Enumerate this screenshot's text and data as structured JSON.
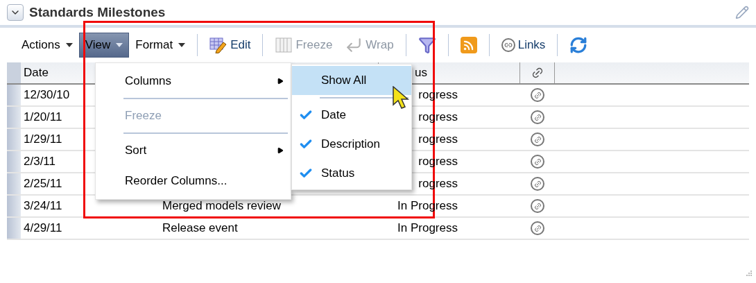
{
  "panel": {
    "title": "Standards Milestones",
    "expanded": true
  },
  "toolbar": [
    {
      "kind": "menu",
      "label": "Actions",
      "selected": false,
      "disabled": false
    },
    {
      "kind": "menu",
      "label": "View",
      "selected": true,
      "disabled": false
    },
    {
      "kind": "menu",
      "label": "Format",
      "selected": false,
      "disabled": false
    },
    {
      "kind": "separator"
    },
    {
      "kind": "edit",
      "label": "Edit",
      "selected": false,
      "disabled": false
    },
    {
      "kind": "separator"
    },
    {
      "kind": "freeze",
      "label": "Freeze",
      "selected": false,
      "disabled": true
    },
    {
      "kind": "wrap",
      "label": "Wrap",
      "selected": false,
      "disabled": true
    },
    {
      "kind": "separator"
    },
    {
      "kind": "filter",
      "selected": false
    },
    {
      "kind": "separator"
    },
    {
      "kind": "rss",
      "selected": false
    },
    {
      "kind": "separator"
    },
    {
      "kind": "links",
      "label": "Links",
      "selected": false,
      "disabled": false
    },
    {
      "kind": "separator"
    },
    {
      "kind": "refresh",
      "selected": false
    }
  ],
  "table": {
    "columns": [
      {
        "kind": "text",
        "label": "Date"
      },
      {
        "kind": "text"
      },
      {
        "kind": "text",
        "label": "us"
      },
      {
        "kind": "link"
      }
    ],
    "rows": [
      {
        "date": "12/30/10",
        "status": "rogress"
      },
      {
        "date": "1/20/11",
        "status": "rogress"
      },
      {
        "date": "1/29/11",
        "status": "rogress"
      },
      {
        "date": "2/3/11",
        "status": "rogress"
      },
      {
        "date": "2/25/11",
        "status": "rogress"
      },
      {
        "date": "3/24/11",
        "description": "Merged models review",
        "status": "In Progress"
      },
      {
        "date": "4/29/11",
        "description": "Release event",
        "status": "In Progress"
      }
    ]
  },
  "view_menu": [
    {
      "kind": "submenu",
      "label": "Columns",
      "disabled": false
    },
    {
      "kind": "separator"
    },
    {
      "kind": "item",
      "label": "Freeze",
      "disabled": true
    },
    {
      "kind": "separator"
    },
    {
      "kind": "submenu",
      "label": "Sort",
      "disabled": false
    },
    {
      "kind": "item",
      "label": "Reorder Columns...",
      "disabled": false
    }
  ],
  "columns_submenu": [
    {
      "kind": "item",
      "label": "Show All",
      "selected": true
    },
    {
      "kind": "separator"
    },
    {
      "kind": "check",
      "label": "Date",
      "checked": true,
      "selected": false
    },
    {
      "kind": "check",
      "label": "Description",
      "checked": true,
      "selected": false
    },
    {
      "kind": "check",
      "label": "Status",
      "checked": true,
      "selected": false
    }
  ]
}
